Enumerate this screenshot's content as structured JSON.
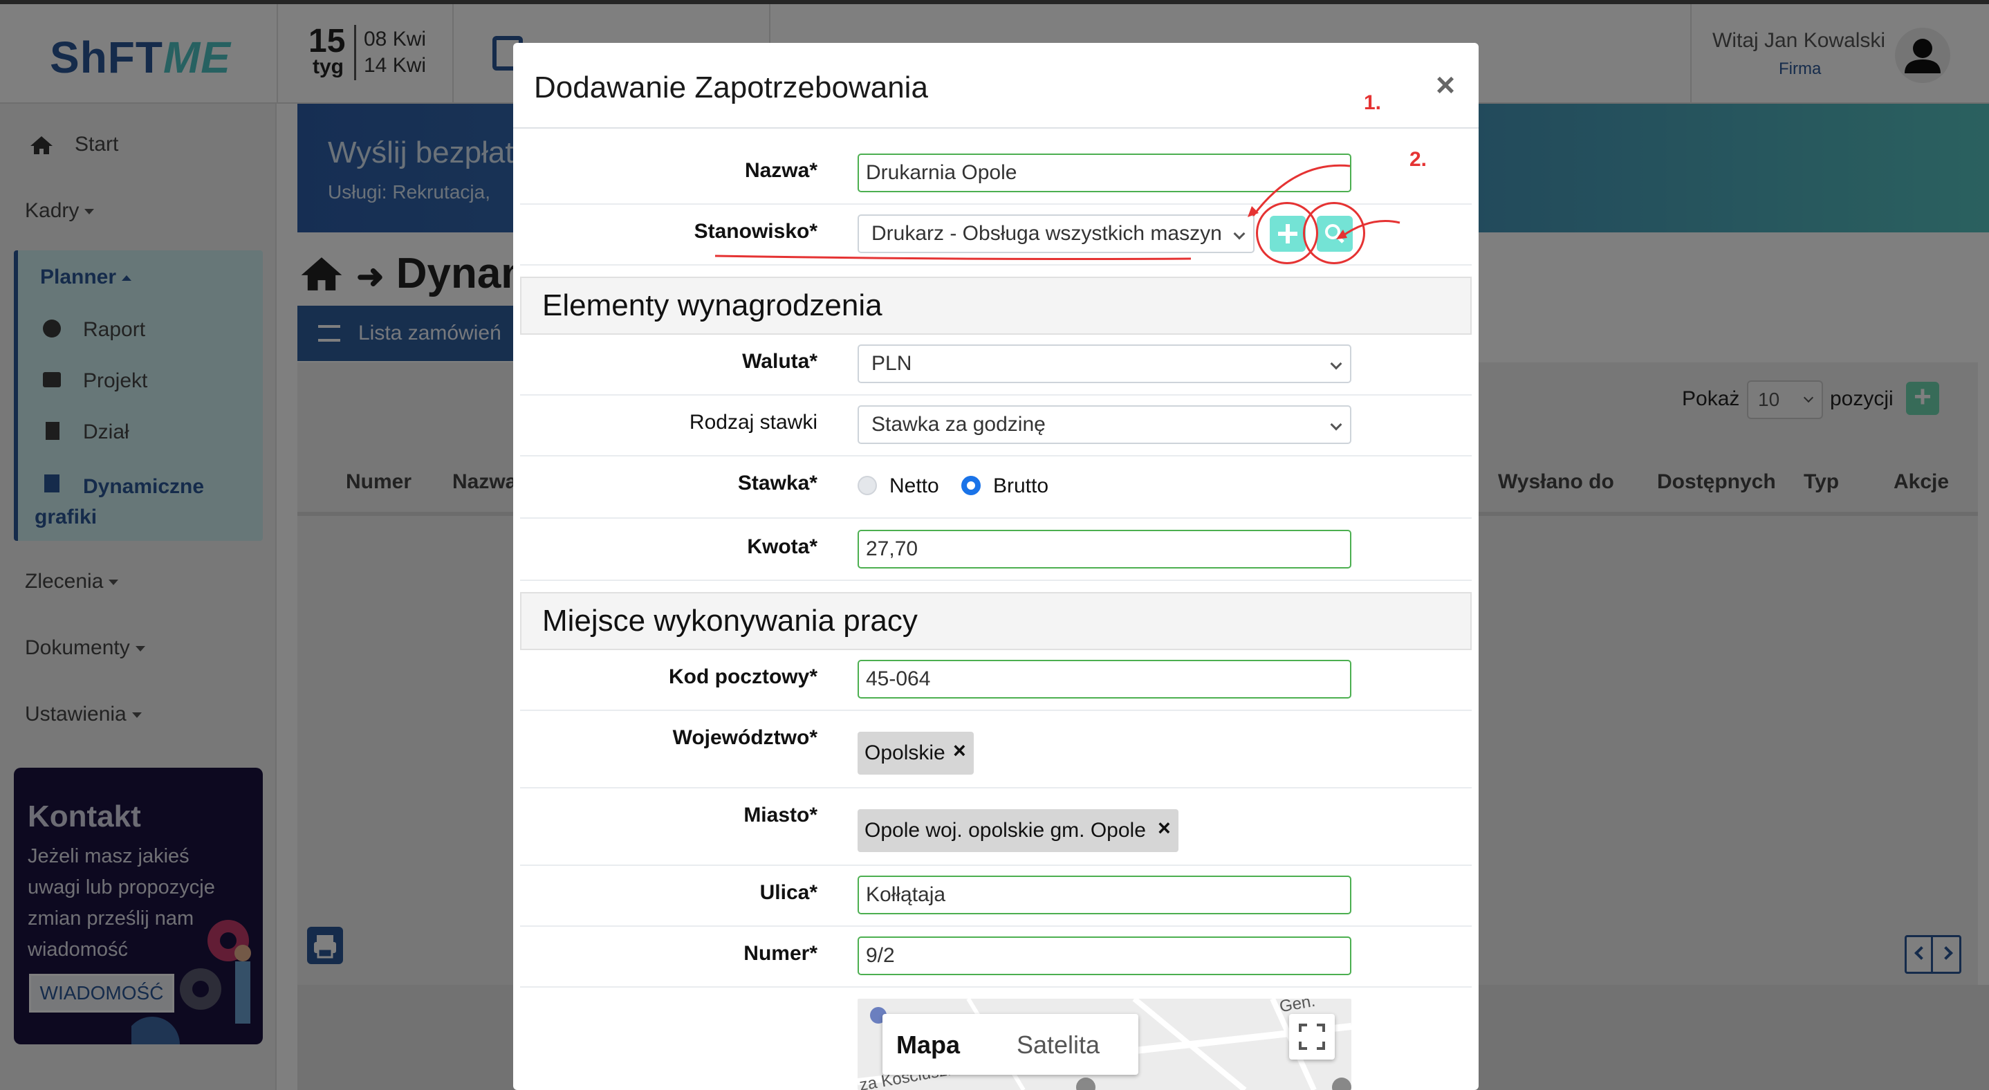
{
  "header": {
    "logo": {
      "part1": "ShFT",
      "part2": "ME"
    },
    "week": {
      "number": "15",
      "label": "tyg",
      "from": "08 Kwi",
      "to": "14 Kwi"
    },
    "user": {
      "greeting": "Witaj Jan Kowalski",
      "company": "Firma"
    }
  },
  "sidebar": {
    "start": "Start",
    "kadry": "Kadry",
    "planner": "Planner",
    "planner_items": [
      "Raport",
      "Projekt",
      "Dział",
      "Dynamiczne grafiki"
    ],
    "zlecenia": "Zlecenia",
    "dokumenty": "Dokumenty",
    "ustawienia": "Ustawienia",
    "kontakt": {
      "title": "Kontakt",
      "text": "Jeżeli masz jakieś uwagi lub propozycje zmian prześlij nam wiadomość",
      "button": "WIADOMOŚĆ"
    }
  },
  "main": {
    "banner_title": "Wyślij bezpłat",
    "banner_sub": "Usługi: Rekrutacja,",
    "breadcrumb": "Dynam",
    "list_tab": "Lista zamówień",
    "pokaz": "Pokaż",
    "page_size": "10",
    "pozycji": "pozycji",
    "columns": {
      "numer": "Numer",
      "nazwa": "Nazwa",
      "wyslano": "Wysłano do",
      "dostepnych": "Dostępnych",
      "typ": "Typ",
      "akcje": "Akcje"
    }
  },
  "modal": {
    "title": "Dodawanie Zapotrzebowania",
    "close": "×",
    "fields": {
      "nazwa": {
        "label": "Nazwa*",
        "value": "Drukarnia Opole"
      },
      "stanowisko": {
        "label": "Stanowisko*",
        "value": "Drukarz - Obsługa wszystkich maszyn"
      },
      "waluta": {
        "label": "Waluta*",
        "value": "PLN"
      },
      "rodzaj": {
        "label": "Rodzaj stawki",
        "value": "Stawka za godzinę"
      },
      "stawka": {
        "label": "Stawka*",
        "opt1": "Netto",
        "opt2": "Brutto",
        "selected": "Brutto"
      },
      "kwota": {
        "label": "Kwota*",
        "value": "27,70"
      },
      "kod": {
        "label": "Kod pocztowy*",
        "value": "45-064"
      },
      "wojewodztwo": {
        "label": "Województwo*",
        "value": "Opolskie"
      },
      "miasto": {
        "label": "Miasto*",
        "value": "Opole woj. opolskie gm. Opole"
      },
      "ulica": {
        "label": "Ulica*",
        "value": "Kołłątaja"
      },
      "numer": {
        "label": "Numer*",
        "value": "9/2"
      }
    },
    "sections": {
      "wynagrodzenie": "Elementy wynagrodzenia",
      "miejsce": "Miejsce wykonywania pracy"
    },
    "map": {
      "tab1": "Mapa",
      "tab2": "Satelita",
      "street1": "za Kościuszk",
      "street2": "Gen."
    }
  },
  "annotations": {
    "one": "1.",
    "two": "2."
  },
  "colors": {
    "brand": "#2b5797",
    "accent": "#74e3d5",
    "valid": "#4caf50",
    "annotation": "#e53333"
  }
}
